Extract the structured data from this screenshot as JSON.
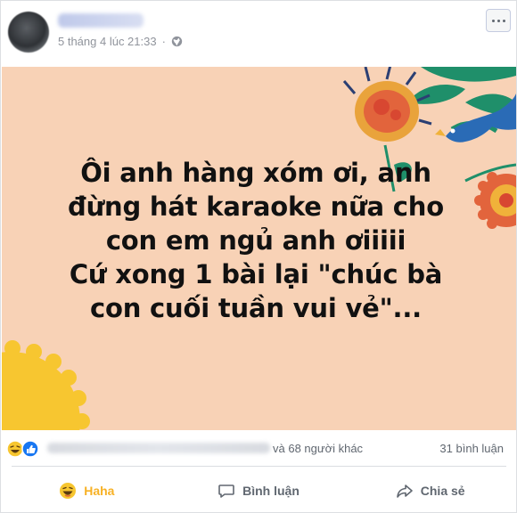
{
  "post": {
    "timestamp": "5 tháng 4 lúc 21:33",
    "privacy_icon": "globe-icon",
    "more_icon": "more-options-icon"
  },
  "content": {
    "text": "Ôi anh hàng xóm ơi, anh\nđừng hát karaoke nữa cho\ncon em ngủ anh ơiiiii\nCứ xong 1 bài lại \"chúc bà\ncon cuối tuần vui vẻ\"...",
    "background_color": "#f8d2b6"
  },
  "reactions": {
    "icons": [
      "haha-icon",
      "like-icon"
    ],
    "others_text": "và 68 người khác",
    "comments_text": "31 bình luận"
  },
  "actions": {
    "haha_label": "Haha",
    "comment_label": "Bình luận",
    "share_label": "Chia sẻ"
  },
  "colors": {
    "haha_active": "#f7b125",
    "like_blue": "#1877f2",
    "text_muted": "#606770"
  }
}
